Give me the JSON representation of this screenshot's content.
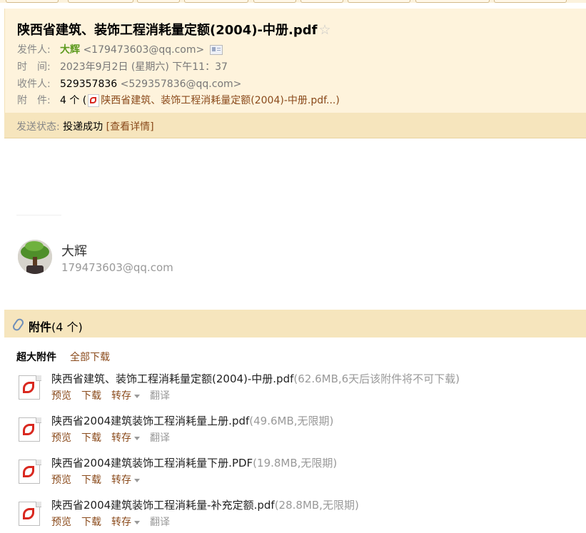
{
  "header": {
    "subject": "陕西省建筑、装饰工程消耗量定额(2004)-中册.pdf",
    "star_icon": "☆",
    "from_label": "发件人:",
    "from_name": "大辉",
    "from_email": "<179473603@qq.com>",
    "time_label": "时　间:",
    "time_value": "2023年9月2日 (星期六) 下午11：37",
    "to_label": "收件人:",
    "to_name": "529357836",
    "to_email": "<529357836@qq.com>",
    "attach_label": "附　件:",
    "attach_count": "4 个 (",
    "attach_first": "陕西省建筑、装饰工程消耗量定额(2004)-中册.pdf...",
    "attach_close": ")"
  },
  "status": {
    "label": "发送状态:",
    "value": "投递成功",
    "link": "[查看详情]"
  },
  "sender_card": {
    "name": "大辉",
    "email": "179473603@qq.com"
  },
  "attachments": {
    "title": "附件",
    "count": "(4 个)",
    "section_label": "超大附件",
    "download_all": "全部下载",
    "files": [
      {
        "name": "陕西省建筑、装饰工程消耗量定额(2004)-中册.pdf",
        "meta": "(62.6MB,6天后该附件将不可下载)",
        "preview": "预览",
        "download": "下载",
        "save": "转存",
        "translate": "翻译"
      },
      {
        "name": "陕西省2004建筑装饰工程消耗量上册.pdf",
        "meta": "(49.6MB,无限期)",
        "preview": "预览",
        "download": "下载",
        "save": "转存",
        "translate": "翻译"
      },
      {
        "name": "陕西省2004建筑装饰工程消耗量下册.PDF",
        "meta": "(19.8MB,无限期)",
        "preview": "预览",
        "download": "下载",
        "save": "转存",
        "translate": ""
      },
      {
        "name": "陕西省2004建筑装饰工程消耗量-补充定额.pdf",
        "meta": "(28.8MB,无限期)",
        "preview": "预览",
        "download": "下载",
        "save": "转存",
        "translate": "翻译"
      }
    ]
  },
  "colors": {
    "header_bg": "#fef3dc",
    "status_bg": "#f6e5bd",
    "link": "#8a4a1b",
    "sender_green": "#5c9a1e",
    "pdf_red": "#d9281f"
  }
}
